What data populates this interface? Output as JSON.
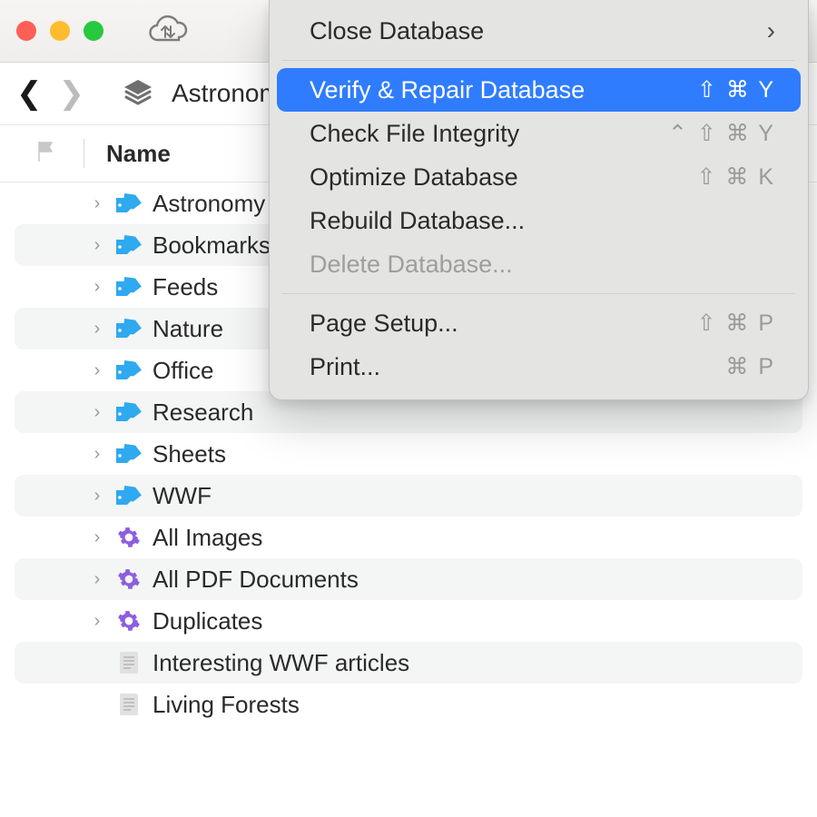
{
  "breadcrumb": {
    "label": "Astronom"
  },
  "column_header": "Name",
  "rows": [
    {
      "label": "Astronomy",
      "type": "tag",
      "disclosure": true,
      "alt": false
    },
    {
      "label": "Bookmarks",
      "type": "tag",
      "disclosure": true,
      "alt": true
    },
    {
      "label": "Feeds",
      "type": "tag",
      "disclosure": true,
      "alt": false
    },
    {
      "label": "Nature",
      "type": "tag",
      "disclosure": true,
      "alt": true
    },
    {
      "label": "Office",
      "type": "tag",
      "disclosure": true,
      "alt": false
    },
    {
      "label": "Research",
      "type": "tag",
      "disclosure": true,
      "alt": true
    },
    {
      "label": "Sheets",
      "type": "tag",
      "disclosure": true,
      "alt": false
    },
    {
      "label": "WWF",
      "type": "tag",
      "disclosure": true,
      "alt": true
    },
    {
      "label": "All Images",
      "type": "gear",
      "disclosure": true,
      "alt": false
    },
    {
      "label": "All PDF Documents",
      "type": "gear",
      "disclosure": true,
      "alt": true
    },
    {
      "label": "Duplicates",
      "type": "gear",
      "disclosure": true,
      "alt": false
    },
    {
      "label": "Interesting WWF articles",
      "type": "doc",
      "disclosure": false,
      "alt": true
    },
    {
      "label": "Living Forests",
      "type": "doc",
      "disclosure": false,
      "alt": false
    }
  ],
  "menu": {
    "groups": [
      [
        {
          "label": "Close Database",
          "shortcut": "",
          "submenu": true
        }
      ],
      [
        {
          "label": "Verify & Repair Database",
          "shortcut": "⇧ ⌘ Y",
          "highlight": true
        },
        {
          "label": "Check File Integrity",
          "shortcut": "⌃ ⇧ ⌘ Y"
        },
        {
          "label": "Optimize Database",
          "shortcut": "⇧ ⌘ K"
        },
        {
          "label": "Rebuild Database...",
          "shortcut": ""
        },
        {
          "label": "Delete Database...",
          "shortcut": "",
          "disabled": true
        }
      ],
      [
        {
          "label": "Page Setup...",
          "shortcut": "⇧ ⌘ P"
        },
        {
          "label": "Print...",
          "shortcut": "⌘ P"
        }
      ]
    ]
  }
}
